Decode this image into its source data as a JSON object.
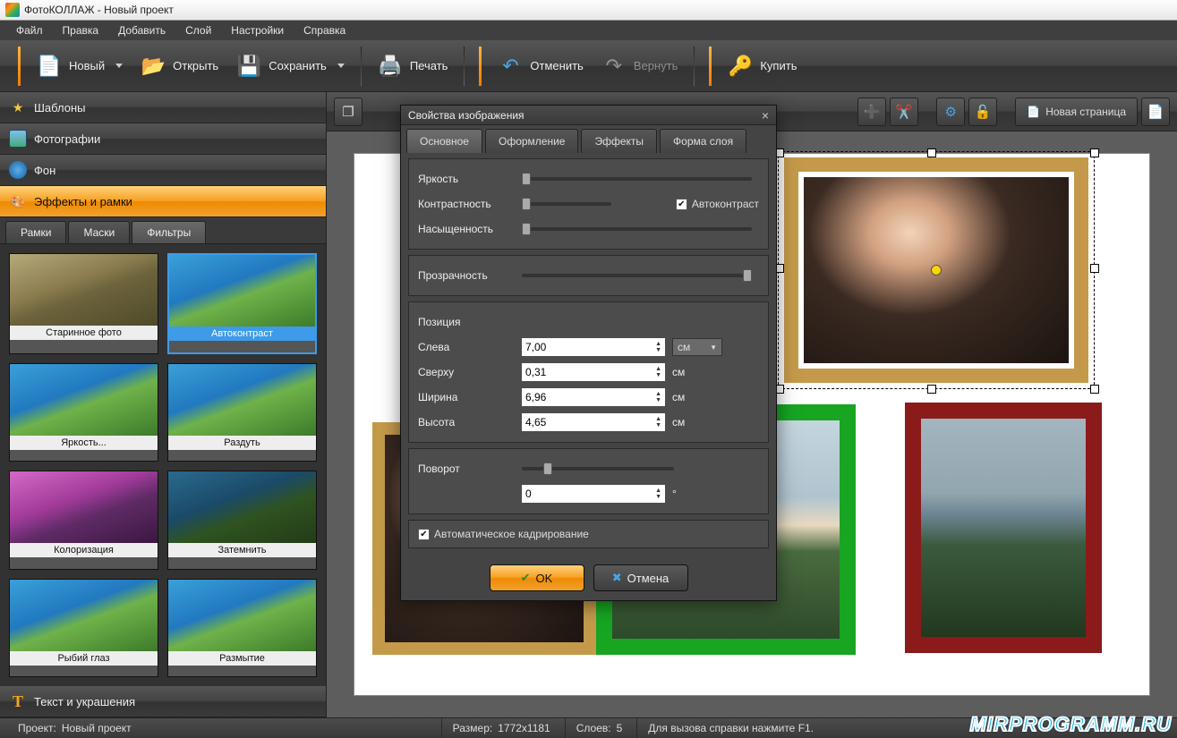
{
  "titlebar": {
    "text": "ФотоКОЛЛАЖ - Новый проект"
  },
  "menu": {
    "file": "Файл",
    "edit": "Правка",
    "add": "Добавить",
    "layer": "Слой",
    "settings": "Настройки",
    "help": "Справка"
  },
  "toolbar": {
    "new": "Новый",
    "open": "Открыть",
    "save": "Сохранить",
    "print": "Печать",
    "undo": "Отменить",
    "redo": "Вернуть",
    "buy": "Купить"
  },
  "accordion": {
    "templates": "Шаблоны",
    "photos": "Фотографии",
    "background": "Фон",
    "effects": "Эффекты и рамки",
    "text": "Текст и украшения"
  },
  "subtabs": {
    "frames": "Рамки",
    "masks": "Маски",
    "filters": "Фильтры"
  },
  "filters": {
    "old_photo": "Старинное фото",
    "autocontrast": "Автоконтраст",
    "brightness": "Яркость...",
    "inflate": "Раздуть",
    "colorize": "Колоризация",
    "darken": "Затемнить",
    "fisheye": "Рыбий глаз",
    "blur": "Размытие"
  },
  "canvas_toolbar": {
    "new_page": "Новая страница"
  },
  "dialog": {
    "title": "Свойства изображения",
    "tabs": {
      "main": "Основное",
      "design": "Оформление",
      "effects": "Эффекты",
      "shape": "Форма слоя"
    },
    "labels": {
      "brightness": "Яркость",
      "contrast": "Контрастность",
      "saturation": "Насыщенность",
      "autocontrast": "Автоконтраст",
      "opacity": "Прозрачность",
      "position": "Позиция",
      "left": "Слева",
      "top": "Сверху",
      "width": "Ширина",
      "height": "Высота",
      "rotation": "Поворот",
      "autocrop": "Автоматическое кадрирование",
      "unit": "см",
      "deg": "°"
    },
    "values": {
      "left": "7,00",
      "top": "0,31",
      "width": "6,96",
      "height": "4,65",
      "rotation": "0"
    },
    "buttons": {
      "ok": "OK",
      "cancel": "Отмена"
    }
  },
  "status": {
    "project_lbl": "Проект:",
    "project_val": "Новый проект",
    "size_lbl": "Размер:",
    "size_val": "1772x1181",
    "layers_lbl": "Слоев:",
    "layers_val": "5",
    "help": "Для вызова справки нажмите F1."
  },
  "watermark": "MIRPROGRAMM.RU"
}
